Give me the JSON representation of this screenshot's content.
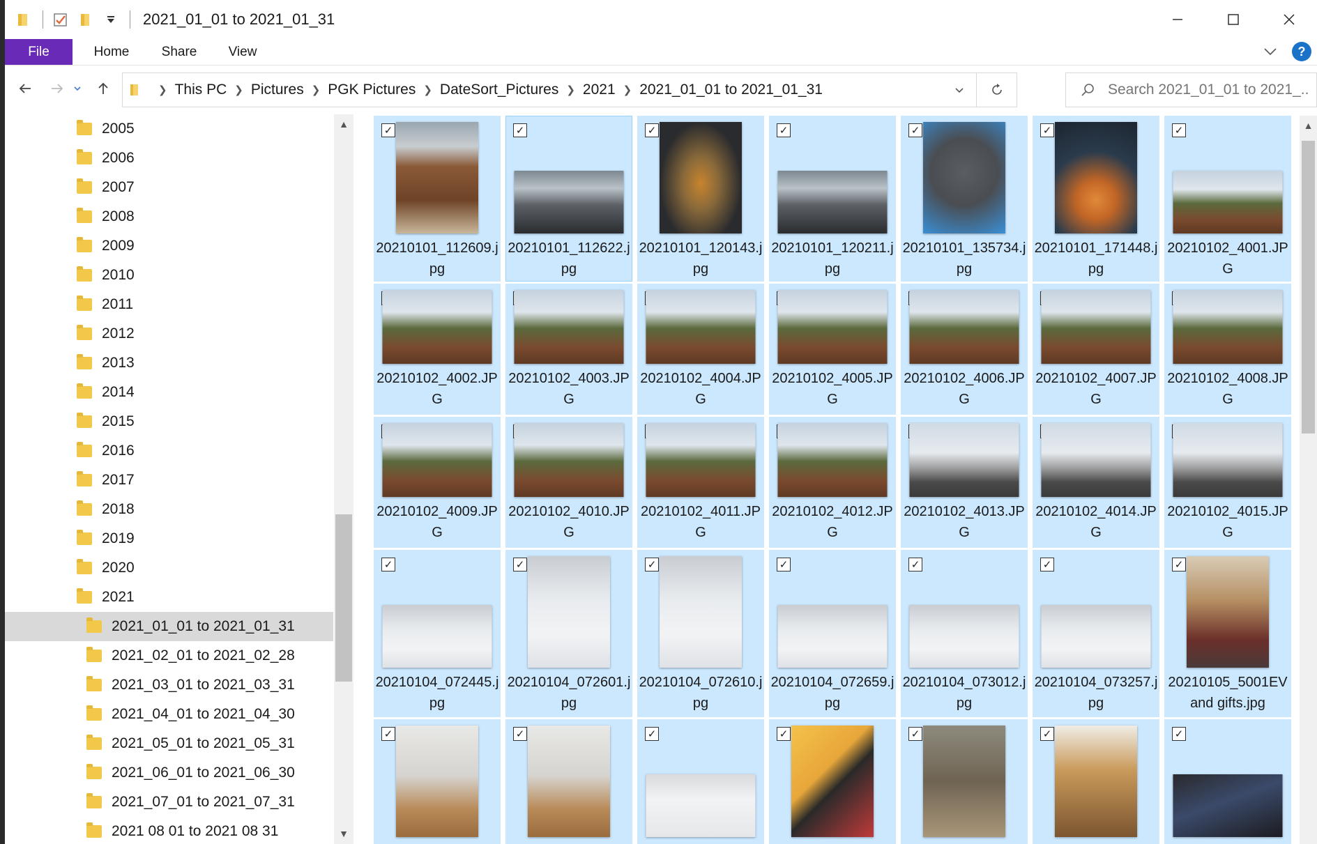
{
  "window": {
    "title": "2021_01_01 to 2021_01_31"
  },
  "ribbon": {
    "tabs": [
      "File",
      "Home",
      "Share",
      "View"
    ]
  },
  "address": {
    "crumbs": [
      "This PC",
      "Pictures",
      "PGK Pictures",
      "DateSort_Pictures",
      "2021",
      "2021_01_01 to 2021_01_31"
    ]
  },
  "search": {
    "placeholder": "Search 2021_01_01 to 2021_..."
  },
  "tree": {
    "items": [
      "2005",
      "2006",
      "2007",
      "2008",
      "2009",
      "2010",
      "2011",
      "2012",
      "2013",
      "2014",
      "2015",
      "2016",
      "2017",
      "2018",
      "2019",
      "2020",
      "2021"
    ],
    "subitems": [
      "2021_01_01 to 2021_01_31",
      "2021_02_01 to 2021_02_28",
      "2021_03_01 to 2021_03_31",
      "2021_04_01 to 2021_04_30",
      "2021_05_01 to 2021_05_31",
      "2021_06_01 to 2021_06_30",
      "2021_07_01 to 2021_07_31",
      "2021 08 01 to 2021 08 31"
    ],
    "selected": "2021_01_01 to 2021_01_31"
  },
  "files": [
    {
      "name": "20210101_112609.jpg",
      "style": "kitchen",
      "orient": "portrait"
    },
    {
      "name": "20210101_112622.jpg",
      "style": "sink",
      "orient": "landscape"
    },
    {
      "name": "20210101_120143.jpg",
      "style": "hand",
      "orient": "portrait"
    },
    {
      "name": "20210101_120211.jpg",
      "style": "sink",
      "orient": "landscape"
    },
    {
      "name": "20210101_135734.jpg",
      "style": "filter",
      "orient": "portrait"
    },
    {
      "name": "20210101_171448.jpg",
      "style": "food",
      "orient": "portrait"
    },
    {
      "name": "20210102_4001.JPG",
      "style": "house",
      "orient": "landscape"
    },
    {
      "name": "20210102_4002.JPG",
      "style": "house",
      "orient": "landscape"
    },
    {
      "name": "20210102_4003.JPG",
      "style": "house",
      "orient": "landscape"
    },
    {
      "name": "20210102_4004.JPG",
      "style": "house",
      "orient": "landscape"
    },
    {
      "name": "20210102_4005.JPG",
      "style": "house",
      "orient": "landscape"
    },
    {
      "name": "20210102_4006.JPG",
      "style": "house",
      "orient": "landscape"
    },
    {
      "name": "20210102_4007.JPG",
      "style": "house",
      "orient": "landscape"
    },
    {
      "name": "20210102_4008.JPG",
      "style": "house",
      "orient": "landscape"
    },
    {
      "name": "20210102_4009.JPG",
      "style": "house",
      "orient": "landscape"
    },
    {
      "name": "20210102_4010.JPG",
      "style": "house",
      "orient": "landscape"
    },
    {
      "name": "20210102_4011.JPG",
      "style": "house",
      "orient": "landscape"
    },
    {
      "name": "20210102_4012.JPG",
      "style": "house",
      "orient": "landscape"
    },
    {
      "name": "20210102_4013.JPG",
      "style": "house2",
      "orient": "landscape"
    },
    {
      "name": "20210102_4014.JPG",
      "style": "house2",
      "orient": "landscape"
    },
    {
      "name": "20210102_4015.JPG",
      "style": "house2",
      "orient": "landscape"
    },
    {
      "name": "20210104_072445.jpg",
      "style": "snow",
      "orient": "landscape"
    },
    {
      "name": "20210104_072601.jpg",
      "style": "snow",
      "orient": "portrait"
    },
    {
      "name": "20210104_072610.jpg",
      "style": "snow",
      "orient": "portrait"
    },
    {
      "name": "20210104_072659.jpg",
      "style": "snow",
      "orient": "landscape"
    },
    {
      "name": "20210104_073012.jpg",
      "style": "snow",
      "orient": "landscape"
    },
    {
      "name": "20210104_073257.jpg",
      "style": "snow",
      "orient": "landscape"
    },
    {
      "name": "20210105_5001EV and gifts.jpg",
      "style": "person",
      "orient": "portrait"
    },
    {
      "name": "",
      "style": "room",
      "orient": "portrait"
    },
    {
      "name": "",
      "style": "room",
      "orient": "portrait"
    },
    {
      "name": "",
      "style": "screen",
      "orient": "landscape"
    },
    {
      "name": "",
      "style": "comic",
      "orient": "portrait"
    },
    {
      "name": "",
      "style": "woods",
      "orient": "portrait"
    },
    {
      "name": "",
      "style": "frames",
      "orient": "portrait"
    },
    {
      "name": "",
      "style": "monitor",
      "orient": "landscape"
    }
  ],
  "colors": {
    "file_tab": "#6a2ab8",
    "selection": "#cce8ff",
    "tree_selected": "#d9d9d9",
    "folder": "#f2c84b"
  },
  "icons": {
    "quick_access": [
      "folder-icon",
      "properties-check-icon",
      "new-folder-icon",
      "customize-dropdown-icon"
    ],
    "nav": [
      "back-arrow-icon",
      "forward-arrow-icon",
      "recent-dropdown-icon",
      "up-arrow-icon"
    ],
    "search": "magnifier-icon",
    "refresh": "refresh-icon"
  }
}
